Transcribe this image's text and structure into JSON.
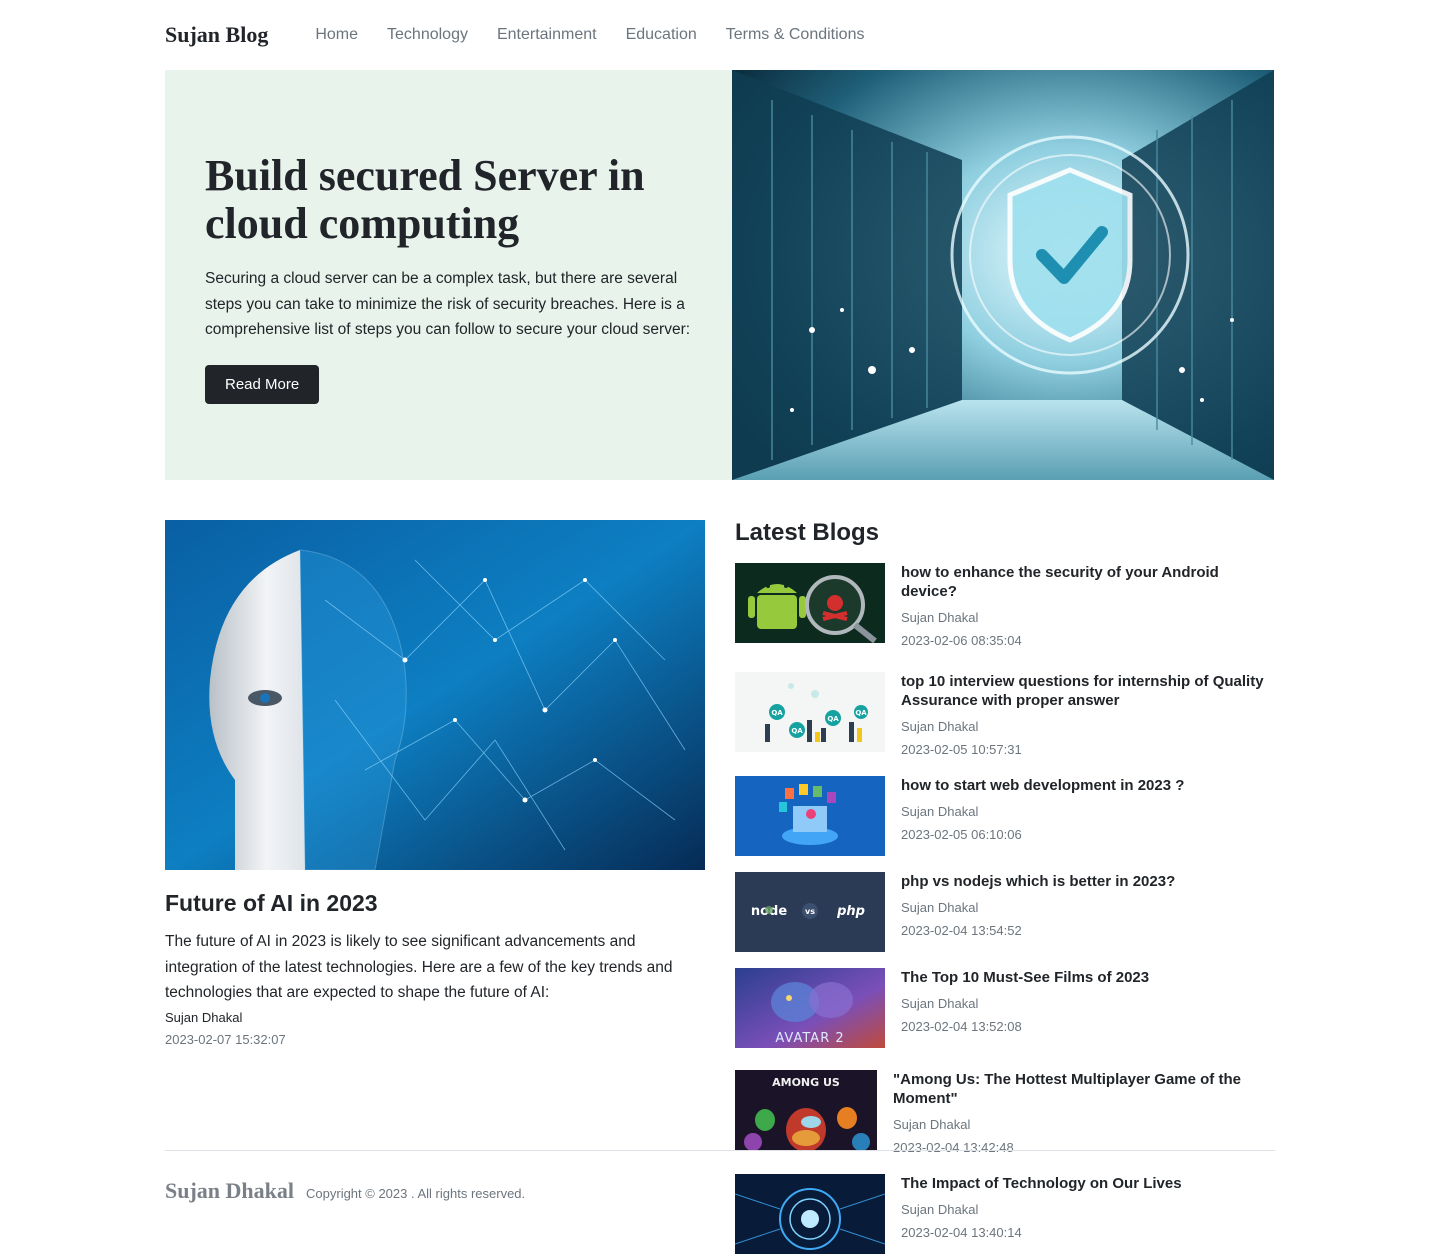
{
  "brand": "Sujan Blog",
  "nav": [
    "Home",
    "Technology",
    "Entertainment",
    "Education",
    "Terms & Conditions"
  ],
  "hero": {
    "title": "Build secured Server in cloud computing",
    "description": "Securing a cloud server can be a complex task, but there are several steps you can take to minimize the risk of security breaches. Here is a comprehensive list of steps you can follow to secure your cloud server:",
    "button": "Read More",
    "bg_color": "#e8f3ec"
  },
  "featured": {
    "title": "Future of AI in 2023",
    "description": "The future of AI in 2023 is likely to see significant advancements and integration of the latest technologies. Here are a few of the key trends and technologies that are expected to shape the future of AI:",
    "author": "Sujan Dhakal",
    "date": "2023-02-07 15:32:07"
  },
  "latest": {
    "heading": "Latest Blogs",
    "posts": [
      {
        "title": "how to enhance the security of your Android device?",
        "author": "Sujan Dhakal",
        "date": "2023-02-06 08:35:04",
        "thumb": "android-security"
      },
      {
        "title": "top 10 interview questions for internship of Quality Assurance with proper answer",
        "author": "Sujan Dhakal",
        "date": "2023-02-05 10:57:31",
        "thumb": "qa-team"
      },
      {
        "title": "how to start web development in 2023 ?",
        "author": "Sujan Dhakal",
        "date": "2023-02-05 06:10:06",
        "thumb": "web-dev"
      },
      {
        "title": "php vs nodejs which is better in 2023?",
        "author": "Sujan Dhakal",
        "date": "2023-02-04 13:54:52",
        "thumb": "node-vs-php"
      },
      {
        "title": "The Top 10 Must-See Films of 2023",
        "author": "Sujan Dhakal",
        "date": "2023-02-04 13:52:08",
        "thumb": "avatar-2"
      },
      {
        "title": "\"Among Us: The Hottest Multiplayer Game of the Moment\"",
        "author": "Sujan Dhakal",
        "date": "2023-02-04 13:42:48",
        "thumb": "among-us"
      },
      {
        "title": "The Impact of Technology on Our Lives",
        "author": "Sujan Dhakal",
        "date": "2023-02-04 13:40:14",
        "thumb": "tech-brain"
      }
    ]
  },
  "thumb_text": {
    "qa": "QA",
    "node": "node",
    "vs": "vs",
    "php": "php",
    "avatar": "AVATAR 2",
    "among": "AMONG US"
  },
  "footer": {
    "brand": "Sujan Dhakal",
    "copyright": "Copyright © 2023 . All rights reserved."
  }
}
